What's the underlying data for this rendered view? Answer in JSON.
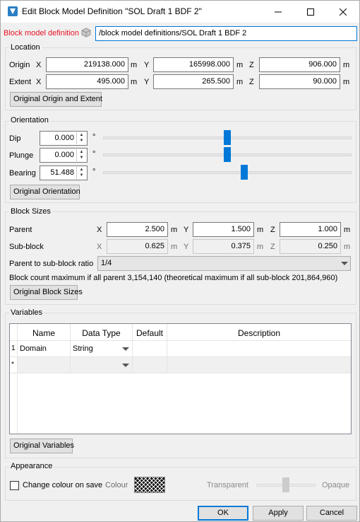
{
  "window": {
    "title": "Edit Block Model Definition \"SOL Draft 1 BDF 2\"",
    "minimize_icon": "minimize-icon",
    "maximize_icon": "maximize-icon",
    "close_icon": "close-icon"
  },
  "definition": {
    "label": "Block model definition",
    "path": "/block model definitions/SOL Draft 1 BDF 2",
    "label_color": "#e81123"
  },
  "location": {
    "title": "Location",
    "origin_label": "Origin",
    "extent_label": "Extent",
    "x": "X",
    "y": "Y",
    "z": "Z",
    "unit": "m",
    "origin": {
      "x": "219138.000",
      "y": "165998.000",
      "z": "906.000"
    },
    "extent": {
      "x": "495.000",
      "y": "265.500",
      "z": "90.000"
    },
    "reset_button": "Original Origin and Extent"
  },
  "orientation": {
    "title": "Orientation",
    "degree": "°",
    "dip": {
      "label": "Dip",
      "value": "0.000",
      "slider_fraction": 0.5
    },
    "plunge": {
      "label": "Plunge",
      "value": "0.000",
      "slider_fraction": 0.5
    },
    "bearing": {
      "label": "Bearing",
      "value": "51.488",
      "slider_fraction": 0.57
    },
    "reset_button": "Original Orientation"
  },
  "block_sizes": {
    "title": "Block Sizes",
    "parent_label": "Parent",
    "subblock_label": "Sub-block",
    "x": "X",
    "y": "Y",
    "z": "Z",
    "unit": "m",
    "parent": {
      "x": "2.500",
      "y": "1.500",
      "z": "1.000"
    },
    "subblock": {
      "x": "0.625",
      "y": "0.375",
      "z": "0.250"
    },
    "ratio_label": "Parent to sub-block ratio",
    "ratio_value": "1/4",
    "count_text": "Block count maximum if all parent 3,154,140 (theoretical maximum if all sub-block 201,864,960)",
    "reset_button": "Original Block Sizes"
  },
  "variables": {
    "title": "Variables",
    "columns": [
      "Name",
      "Data Type",
      "Default",
      "Description"
    ],
    "rows": [
      {
        "index": "1",
        "name": "Domain",
        "type": "String",
        "default": "",
        "description": ""
      }
    ],
    "new_row_marker": "*",
    "reset_button": "Original Variables"
  },
  "appearance": {
    "title": "Appearance",
    "change_colour_label": "Change colour on save",
    "change_colour_checked": false,
    "colour_label": "Colour",
    "transparent_label": "Transparent",
    "opaque_label": "Opaque",
    "opacity_fraction": 0.5
  },
  "footer": {
    "ok": "OK",
    "apply": "Apply",
    "cancel": "Cancel"
  },
  "colors": {
    "accent": "#0078d7",
    "error_label": "#e81123",
    "app_icon": "#2b7fc4"
  }
}
